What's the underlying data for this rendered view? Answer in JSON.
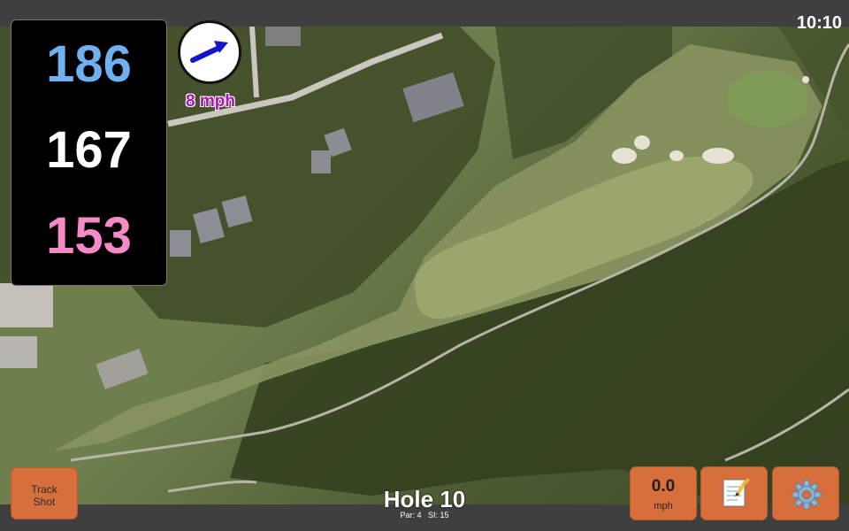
{
  "status": {
    "time": "10:10"
  },
  "distances": {
    "back": "186",
    "middle": "167",
    "front": "153"
  },
  "wind": {
    "speed_label": "8 mph",
    "icon": "wind-arrow-icon"
  },
  "controls": {
    "track_shot_line1": "Track",
    "track_shot_line2": "Shot",
    "speed_value": "0.0",
    "speed_unit": "mph",
    "notes_icon": "notepad-icon",
    "settings_icon": "gear-icon"
  },
  "hole": {
    "title": "Hole 10",
    "par_label": "Par: 4",
    "si_label": "SI: 15"
  },
  "colors": {
    "back": "#6fb1ee",
    "middle": "#ffffff",
    "front": "#f48bc6",
    "wind_text": "#b10fb8",
    "button": "#d76f3c"
  }
}
